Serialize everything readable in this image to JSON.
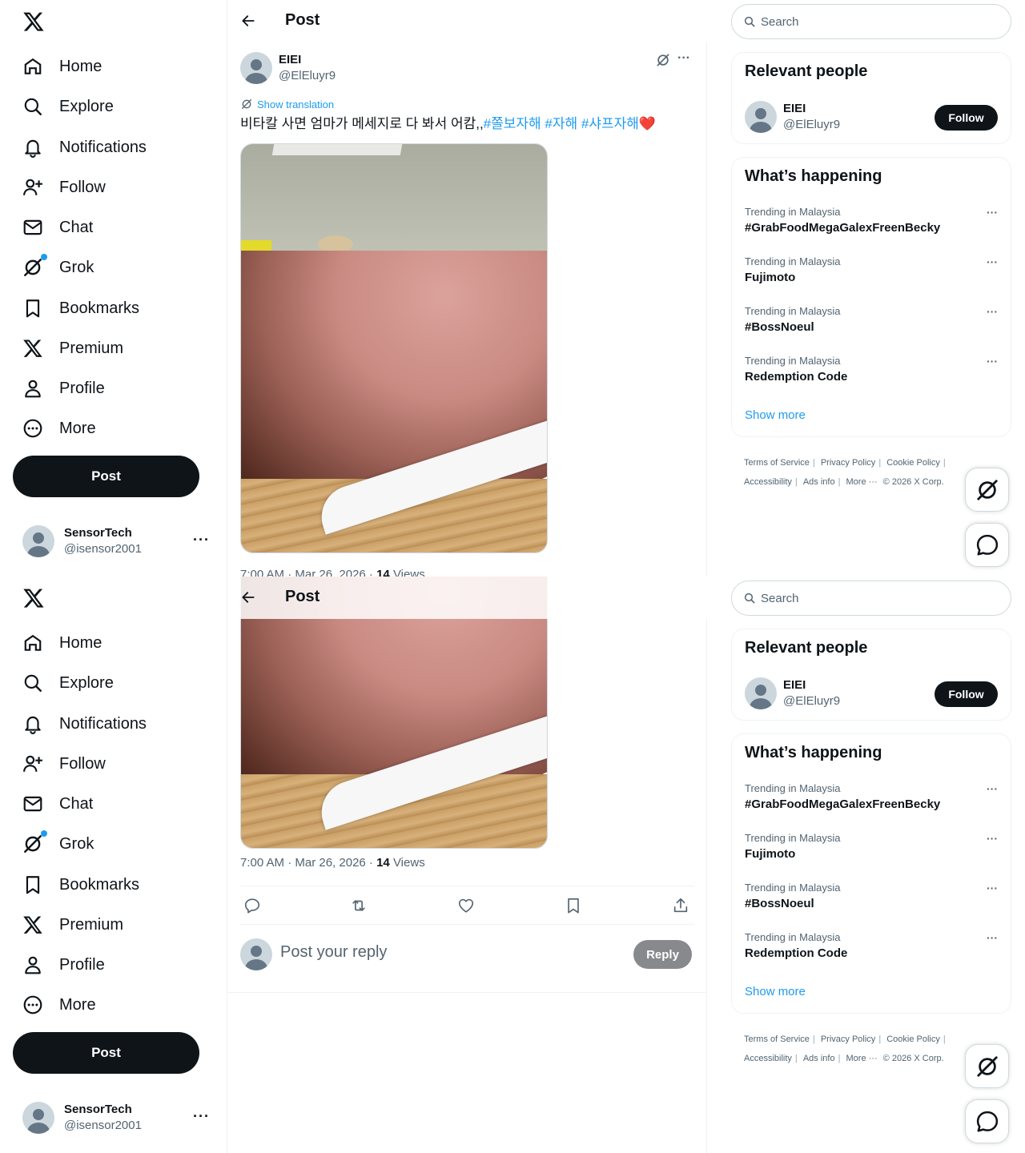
{
  "nav": {
    "items": [
      {
        "label": "Home",
        "icon": "home-icon"
      },
      {
        "label": "Explore",
        "icon": "search-icon"
      },
      {
        "label": "Notifications",
        "icon": "bell-icon"
      },
      {
        "label": "Follow",
        "icon": "add-person-icon"
      },
      {
        "label": "Chat",
        "icon": "envelope-icon"
      },
      {
        "label": "Grok",
        "icon": "grok-icon"
      },
      {
        "label": "Bookmarks",
        "icon": "bookmark-icon"
      },
      {
        "label": "Premium",
        "icon": "x-logo-icon"
      },
      {
        "label": "Profile",
        "icon": "person-icon"
      },
      {
        "label": "More",
        "icon": "more-circle-icon"
      }
    ],
    "post_button": "Post",
    "account": {
      "name": "SensorTech",
      "handle": "@isensor2001",
      "more": "···"
    }
  },
  "header": {
    "title": "Post"
  },
  "tweet": {
    "author_name": "EIEI",
    "author_handle": "@ElEluyr9",
    "show_translation": "Show translation",
    "text_plain": "비타칼 사면 엄마가 메세지로 다 봐서 어캄,,",
    "hashtags": [
      "#쫄보자해",
      "#자해",
      "#샤프자해"
    ],
    "emoji": "❤️",
    "time": "7:00 AM · Mar 26, 2026 · ",
    "views_count": "14",
    "views_label": " Views"
  },
  "reply": {
    "placeholder": "Post your reply",
    "button": "Reply"
  },
  "sidebar": {
    "search_placeholder": "Search",
    "relevant_people": {
      "title": "Relevant people",
      "person_name": "EIEI",
      "person_handle": "@ElEluyr9",
      "follow_label": "Follow"
    },
    "whats_happening": {
      "title": "What’s happening",
      "trends": [
        {
          "category": "Trending in Malaysia",
          "name": "#GrabFoodMegaGalexFreenBecky"
        },
        {
          "category": "Trending in Malaysia",
          "name": "Fujimoto"
        },
        {
          "category": "Trending in Malaysia",
          "name": "#BossNoeul"
        },
        {
          "category": "Trending in Malaysia",
          "name": "Redemption Code"
        }
      ],
      "show_more": "Show more"
    },
    "footer": {
      "terms": "Terms of Service",
      "privacy": "Privacy Policy",
      "cookie": "Cookie Policy",
      "accessibility": "Accessibility",
      "ads": "Ads info",
      "more": "More ···",
      "copyright": "© 2026 X Corp."
    }
  },
  "colors": {
    "accent": "#1d9bf0",
    "text": "#0f1419",
    "muted": "#536471",
    "like": "#e0245e"
  }
}
